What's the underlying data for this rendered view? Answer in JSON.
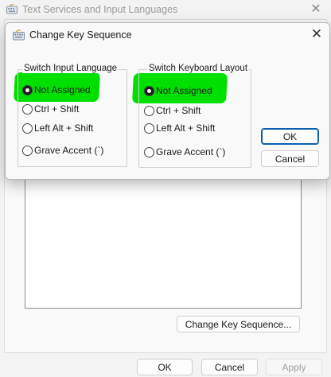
{
  "background_window": {
    "title": "Text Services and Input Languages",
    "close_glyph": "✕",
    "icon": "keyboard-icon",
    "buttons": {
      "change_key_sequence": "Change Key Sequence...",
      "ok": "OK",
      "cancel": "Cancel",
      "apply": "Apply"
    }
  },
  "dialog": {
    "title": "Change Key Sequence",
    "close_glyph": "✕",
    "icon": "keyboard-icon",
    "groups": [
      {
        "legend": "Switch Input Language",
        "options": [
          "Not Assigned",
          "Ctrl + Shift",
          "Left Alt + Shift",
          "Grave Accent (`)"
        ],
        "selected_index": 0
      },
      {
        "legend": "Switch Keyboard Layout",
        "options": [
          "Not Assigned",
          "Ctrl + Shift",
          "Left Alt + Shift",
          "Grave Accent (`)"
        ],
        "selected_index": 0
      }
    ],
    "buttons": {
      "ok": "OK",
      "cancel": "Cancel"
    }
  },
  "colors": {
    "highlight": "#00e000",
    "default_button_border": "#0b5fad"
  }
}
